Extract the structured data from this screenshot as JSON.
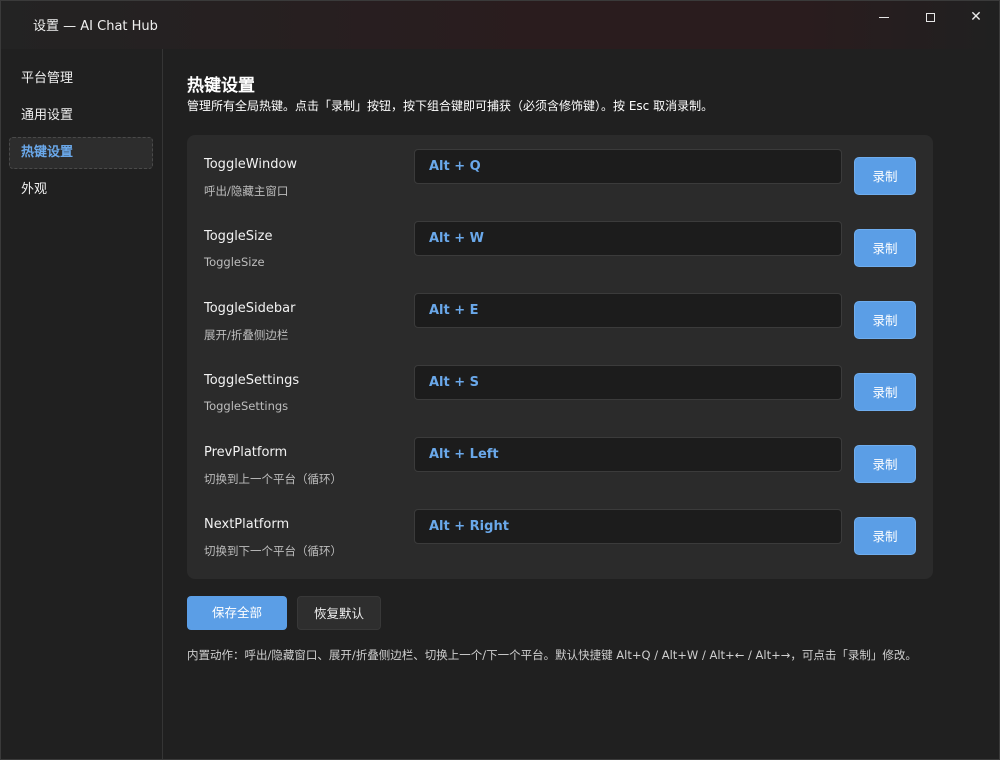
{
  "window": {
    "title": "设置 — AI Chat Hub",
    "controls": {
      "minimize": "minimize-icon",
      "maximize": "maximize-icon",
      "close": "✕"
    }
  },
  "sidebar": {
    "items": [
      {
        "label": "平台管理"
      },
      {
        "label": "通用设置"
      },
      {
        "label": "热键设置",
        "active": true
      },
      {
        "label": "外观"
      }
    ]
  },
  "main": {
    "title": "热键设置",
    "description": "管理所有全局热键。点击「录制」按钮，按下组合键即可捕获（必须含修饰键）。按 Esc 取消录制。",
    "hotkeys": [
      {
        "name": "ToggleWindow",
        "desc": "呼出/隐藏主窗口",
        "value": "Alt + Q",
        "button": "录制"
      },
      {
        "name": "ToggleSize",
        "desc": "ToggleSize",
        "value": "Alt + W",
        "button": "录制"
      },
      {
        "name": "ToggleSidebar",
        "desc": "展开/折叠侧边栏",
        "value": "Alt + E",
        "button": "录制"
      },
      {
        "name": "ToggleSettings",
        "desc": "ToggleSettings",
        "value": "Alt + S",
        "button": "录制"
      },
      {
        "name": "PrevPlatform",
        "desc": "切换到上一个平台（循环）",
        "value": "Alt + Left",
        "button": "录制"
      },
      {
        "name": "NextPlatform",
        "desc": "切换到下一个平台（循环）",
        "value": "Alt + Right",
        "button": "录制"
      }
    ],
    "save_label": "保存全部",
    "reset_label": "恢复默认",
    "footnote": "内置动作：呼出/隐藏窗口、展开/折叠侧边栏、切换上一个/下一个平台。默认快捷键 Alt+Q / Alt+W / Alt+← / Alt+→，可点击「录制」修改。"
  },
  "colors": {
    "accent": "#5b9ee6",
    "accent_text": "#6aa8ea",
    "background": "#202020",
    "card": "#2b2b2b"
  }
}
